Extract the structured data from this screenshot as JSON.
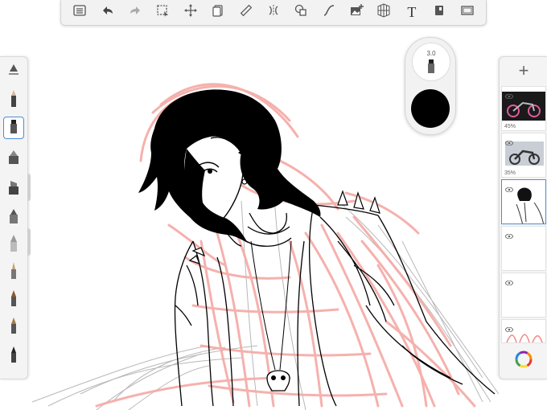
{
  "app": {
    "accent": "#4a8fd8"
  },
  "toolbar": {
    "items": [
      {
        "name": "list-icon"
      },
      {
        "name": "undo-icon"
      },
      {
        "name": "redo-icon"
      },
      {
        "name": "selection-icon"
      },
      {
        "name": "transform-icon"
      },
      {
        "name": "layers-stack-icon"
      },
      {
        "name": "ruler-icon"
      },
      {
        "name": "symmetry-icon"
      },
      {
        "name": "shapes-icon"
      },
      {
        "name": "curve-icon"
      },
      {
        "name": "add-image-icon"
      },
      {
        "name": "perspective-grid-icon"
      },
      {
        "name": "text-icon",
        "label": "T"
      },
      {
        "name": "fill-icon"
      },
      {
        "name": "canvas-icon"
      }
    ]
  },
  "brush_size": {
    "value": "3.0"
  },
  "current_color": "#000000",
  "brushes": [
    {
      "name": "ruler-tool-icon"
    },
    {
      "name": "pencil-icon"
    },
    {
      "name": "marker-icon",
      "selected": true
    },
    {
      "name": "airbrush-icon"
    },
    {
      "name": "chisel-marker-icon"
    },
    {
      "name": "paint-brush-icon"
    },
    {
      "name": "wide-brush-icon"
    },
    {
      "name": "fine-pen-icon"
    },
    {
      "name": "ink-brush-icon"
    },
    {
      "name": "detail-brush-icon"
    },
    {
      "name": "ballpoint-icon"
    }
  ],
  "layers": [
    {
      "name": "layer-motorcycle-pink",
      "opacity": "45%"
    },
    {
      "name": "layer-motorcycle-photo",
      "opacity": "35%"
    },
    {
      "name": "layer-figure-lineart",
      "active": true
    },
    {
      "name": "layer-empty-1"
    },
    {
      "name": "layer-empty-2"
    },
    {
      "name": "layer-sketch-red"
    }
  ],
  "layer_panel": {
    "add_label": "+"
  }
}
